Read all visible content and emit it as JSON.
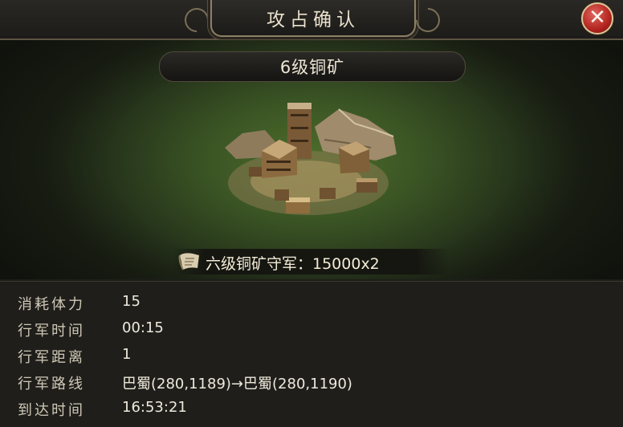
{
  "dialog": {
    "title": "攻占确认",
    "close_icon": "close-x-icon"
  },
  "target": {
    "name": "6级铜矿",
    "garrison_icon": "scroll-icon",
    "garrison_text": "六级铜矿守军：15000x2"
  },
  "info_rows": [
    {
      "label": "消耗体力",
      "value": "15"
    },
    {
      "label": "行军时间",
      "value": "00:15"
    },
    {
      "label": "行军距离",
      "value": "1"
    },
    {
      "label": "行军路线",
      "value": "巴蜀(280,1189)→巴蜀(280,1190)"
    },
    {
      "label": "到达时间",
      "value": "16:53:21"
    }
  ],
  "colors": {
    "accent_gold": "#d8c89a",
    "close_red": "#b3241f",
    "grass_green": "#4f6e2b"
  }
}
